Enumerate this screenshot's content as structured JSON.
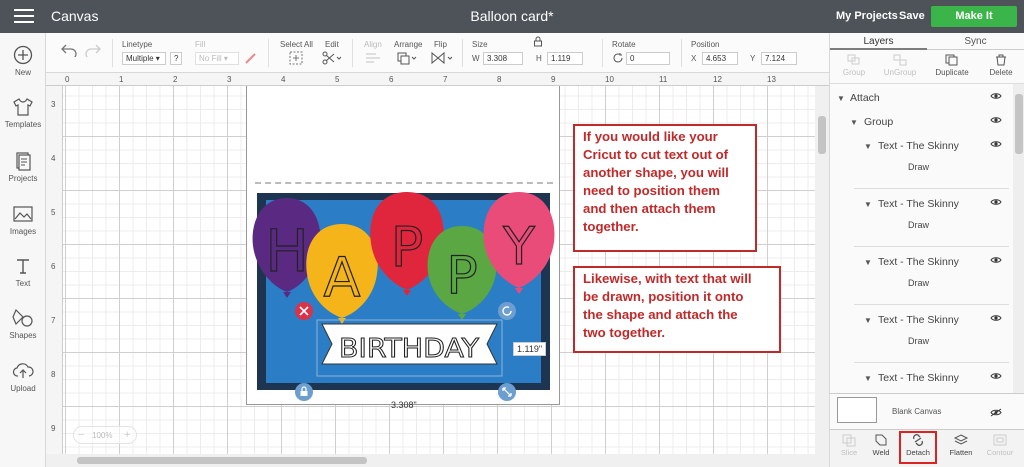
{
  "topbar": {
    "app_title": "Canvas",
    "doc_title": "Balloon card*",
    "my_projects": "My Projects",
    "save": "Save",
    "make_it": "Make It"
  },
  "leftbar": {
    "items": [
      {
        "label": "New",
        "icon": "plus-circle-icon"
      },
      {
        "label": "Templates",
        "icon": "shirt-icon"
      },
      {
        "label": "Projects",
        "icon": "projects-icon"
      },
      {
        "label": "Images",
        "icon": "image-icon"
      },
      {
        "label": "Text",
        "icon": "text-icon"
      },
      {
        "label": "Shapes",
        "icon": "shapes-icon"
      },
      {
        "label": "Upload",
        "icon": "upload-icon"
      }
    ]
  },
  "toolbar": {
    "linetype_label": "Linetype",
    "linetype_value": "Multiple",
    "fill_label": "Fill",
    "fill_value": "No Fill",
    "select_all_label": "Select All",
    "edit_label": "Edit",
    "align_label": "Align",
    "arrange_label": "Arrange",
    "flip_label": "Flip",
    "size_label": "Size",
    "size_w_label": "W",
    "size_w_value": "3.308",
    "size_h_label": "H",
    "size_h_value": "1.119",
    "rotate_label": "Rotate",
    "rotate_value": "0",
    "position_label": "Position",
    "pos_x_label": "X",
    "pos_x_value": "4.653",
    "pos_y_label": "Y",
    "pos_y_value": "7.124",
    "question_mark": "?"
  },
  "rulers": {
    "top": [
      "0",
      "1",
      "2",
      "3",
      "4",
      "5",
      "6",
      "7",
      "8",
      "9",
      "10",
      "11",
      "12",
      "13"
    ],
    "left": [
      "3",
      "4",
      "5",
      "6",
      "7",
      "8",
      "9"
    ]
  },
  "canvas": {
    "card_letters": [
      "H",
      "A",
      "P",
      "P",
      "Y"
    ],
    "banner_text": "BIRTHDAY",
    "height_label": "1.119\"",
    "width_label": "3.308\"",
    "zoom": "100%"
  },
  "notes": {
    "first": [
      "If you would like your",
      "Cricut to cut text out of",
      "another shape, you will",
      "need to position them",
      "and then attach them",
      "together."
    ],
    "second": [
      "Likewise, with text that will",
      "be drawn, position it onto",
      "the shape and attach the",
      "two together."
    ]
  },
  "rightpanel": {
    "tabs": [
      "Layers",
      "Sync"
    ],
    "actions": [
      {
        "label": "Group",
        "icon": "group-icon",
        "enabled": false
      },
      {
        "label": "UnGroup",
        "icon": "ungroup-icon",
        "enabled": false
      },
      {
        "label": "Duplicate",
        "icon": "duplicate-icon",
        "enabled": true
      },
      {
        "label": "Delete",
        "icon": "trash-icon",
        "enabled": true
      }
    ],
    "layers": [
      {
        "label": "Attach",
        "level": 0,
        "kind": "group"
      },
      {
        "label": "Group",
        "level": 1,
        "kind": "group"
      },
      {
        "label": "Text - The Skinny",
        "level": 2,
        "kind": "item",
        "sub": "Draw"
      },
      {
        "label": "Text - The Skinny",
        "level": 2,
        "kind": "item",
        "sub": "Draw"
      },
      {
        "label": "Text - The Skinny",
        "level": 2,
        "kind": "item",
        "sub": "Draw"
      },
      {
        "label": "Text - The Skinny",
        "level": 2,
        "kind": "item",
        "sub": "Draw"
      },
      {
        "label": "Text - The Skinny",
        "level": 2,
        "kind": "item",
        "sub": ""
      }
    ],
    "blank_canvas": "Blank Canvas",
    "bottom_tools": [
      {
        "label": "Slice",
        "icon": "slice-icon",
        "enabled": false
      },
      {
        "label": "Weld",
        "icon": "weld-icon",
        "enabled": true
      },
      {
        "label": "Detach",
        "icon": "detach-icon",
        "enabled": true
      },
      {
        "label": "Flatten",
        "icon": "flatten-icon",
        "enabled": true
      },
      {
        "label": "Contour",
        "icon": "contour-icon",
        "enabled": false
      }
    ]
  },
  "colors": {
    "make_it": "#3bb54a",
    "topbar": "#4d5359",
    "note_border": "#c12a2a",
    "balloon_purple": "#5a2a82",
    "balloon_yellow": "#f4b41a",
    "balloon_red": "#e0263c",
    "balloon_green": "#5aa744",
    "balloon_pink": "#ea4c7a",
    "card_blue": "#2b7ec6",
    "card_frame": "#1e3551"
  }
}
